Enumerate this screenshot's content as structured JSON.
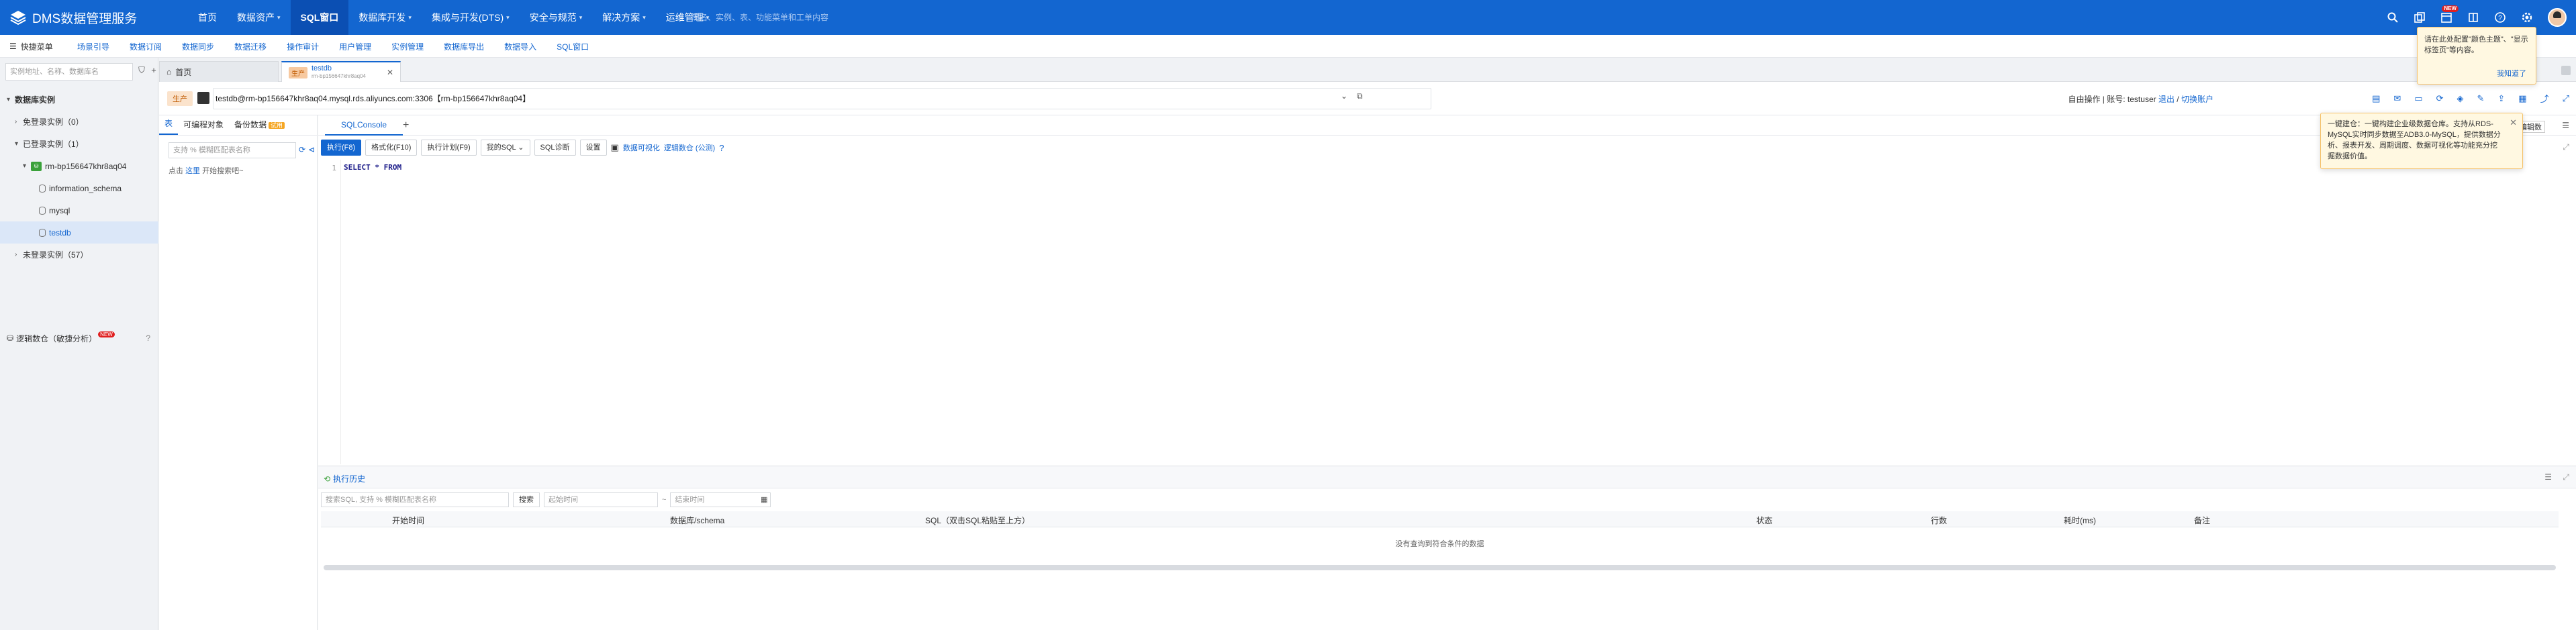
{
  "topbar": {
    "logo_text": "DMS数据管理服务",
    "nav": [
      {
        "label": "首页",
        "caret": false,
        "active": false
      },
      {
        "label": "数据资产",
        "caret": true,
        "active": false
      },
      {
        "label": "SQL窗口",
        "caret": false,
        "active": true
      },
      {
        "label": "数据库开发",
        "caret": true,
        "active": false
      },
      {
        "label": "集成与开发(DTS)",
        "caret": true,
        "active": false
      },
      {
        "label": "安全与规范",
        "caret": true,
        "active": false
      },
      {
        "label": "解决方案",
        "caret": true,
        "active": false
      },
      {
        "label": "运维管理",
        "caret": true,
        "active": false
      }
    ],
    "search_placeholder": "库名、实例、表、功能菜单和工单内容",
    "new_badge": "NEW"
  },
  "subbar": {
    "quick_menu": "快捷菜单",
    "items": [
      "场景引导",
      "数据订阅",
      "数据同步",
      "数据迁移",
      "操作审计",
      "用户管理",
      "实例管理",
      "数据库导出",
      "数据导入",
      "SQL窗口"
    ]
  },
  "sidebar": {
    "search_placeholder": "实例地址、名称、数据库名",
    "tree": [
      {
        "label": "数据库实例",
        "level": 0,
        "arrow": "▾",
        "sel": false,
        "type": "header"
      },
      {
        "label": "免登录实例（0）",
        "level": 1,
        "arrow": "›",
        "sel": false,
        "type": "group"
      },
      {
        "label": "已登录实例（1）",
        "level": 1,
        "arrow": "▾",
        "sel": false,
        "type": "group"
      },
      {
        "label": "rm-bp156647khr8aq04",
        "level": 2,
        "arrow": "▾",
        "sel": false,
        "type": "instance"
      },
      {
        "label": "information_schema",
        "level": 3,
        "arrow": "",
        "sel": false,
        "type": "db"
      },
      {
        "label": "mysql",
        "level": 3,
        "arrow": "",
        "sel": false,
        "type": "db"
      },
      {
        "label": "testdb",
        "level": 3,
        "arrow": "",
        "sel": true,
        "type": "db"
      },
      {
        "label": "未登录实例（57）",
        "level": 1,
        "arrow": "›",
        "sel": false,
        "type": "group"
      }
    ],
    "footer_label": "逻辑数仓（敏捷分析）",
    "footer_badge": "NEW"
  },
  "tabs": {
    "home": "首页",
    "active_env": "生产",
    "active_title": "testdb",
    "active_sub": "rm-bp156647khr8aq04"
  },
  "connbar": {
    "env": "生产",
    "connection": "testdb@rm-bp156647khr8aq04.mysql.rds.aliyuncs.com:3306【rm-bp156647khr8aq04】",
    "mode": "自由操作 | 账号: testuser",
    "logout": "退出",
    "switch": "切换账户"
  },
  "objects": {
    "tabs": [
      "表",
      "可编程对象",
      "备份数据"
    ],
    "backup_badge": "试用",
    "filter_placeholder": "支持 % 模糊匹配表名称",
    "hint_prefix": "点击",
    "hint_link": "这里",
    "hint_suffix": "开始搜索吧~"
  },
  "editor": {
    "tab": "SQLConsole",
    "toolbar": {
      "run": "执行(F8)",
      "format": "格式化(F10)",
      "plan": "执行计划(F9)",
      "common_sql": "我的SQL",
      "diagnose": "SQL诊断",
      "settings": "设置",
      "viz": "数据可视化",
      "logic": "逻辑数仓 (公测)"
    },
    "line_no": "1",
    "code": "SELECT * FROM",
    "edit_data": "编辑数"
  },
  "history": {
    "title": "执行历史",
    "search_placeholder": "搜索SQL, 支持 % 模糊匹配表名称",
    "search_btn": "搜索",
    "start_placeholder": "起始时间",
    "end_placeholder": "结束时间",
    "columns": [
      "开始时间",
      "数据库/schema",
      "SQL（双击SQL粘贴至上方）",
      "状态",
      "行数",
      "耗时(ms)",
      "备注"
    ],
    "empty": "没有查询到符合条件的数据"
  },
  "tips": {
    "tip1_text": "请在此处配置\"颜色主题\"、\"显示标签页\"等内容。",
    "tip1_ok": "我知道了",
    "tip2_text": "一键建仓：一键构建企业级数据仓库。支持从RDS-MySQL实时同步数据至ADB3.0-MySQL，提供数据分析、报表开发、周期调度、数据可视化等功能充分挖掘数据价值。"
  },
  "colors": {
    "primary": "#1366d0",
    "topbar": "#1366d0",
    "active_nav": "#0b4fb3",
    "tip_bg": "#fff8e1"
  }
}
